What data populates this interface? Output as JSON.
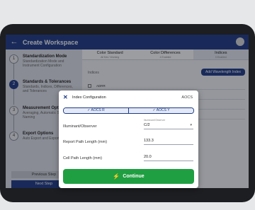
{
  "header": {
    "title": "Create Workspace",
    "back_icon": "arrow-left-icon"
  },
  "steps": [
    {
      "num": "1",
      "title": "Standardization Mode",
      "sub": "Standardization Mode and Instrument Configuration"
    },
    {
      "num": "2",
      "title": "Standards & Tolerances",
      "sub": "Standards, Indices, Differences, and Tolerances"
    },
    {
      "num": "3",
      "title": "Measurement Options",
      "sub": "Averaging, Automatic Sample Naming"
    },
    {
      "num": "4",
      "title": "Export Options",
      "sub": "Auto Export and Export Settings"
    }
  ],
  "sidebar": {
    "prev_label": "Previous Step",
    "next_label": "Next Step"
  },
  "tabs": [
    {
      "label": "Color Standard",
      "sub": "All Mst / Working"
    },
    {
      "label": "Color Differences",
      "sub": "4 Enabled"
    },
    {
      "label": "Indices",
      "sub": "0 Enabled"
    }
  ],
  "content": {
    "section_label": "Indices",
    "add_button": "Add Wavelength Index",
    "rows": [
      "ADRR",
      "",
      "",
      ""
    ]
  },
  "modal": {
    "title": "Index Configuration",
    "right_label": "AOCS",
    "options": [
      {
        "label": "✓ AOCS R"
      },
      {
        "label": "✓ AOCS Y"
      }
    ],
    "fields": [
      {
        "label": "Illuminant/Observer",
        "caption": "Illuminant/Observer",
        "value": "C/2"
      },
      {
        "label": "Report Path Length (mm)",
        "caption": "",
        "value": "133.3"
      },
      {
        "label": "Cell Path Length (mm)",
        "caption": "",
        "value": "20.0"
      }
    ],
    "continue_label": "Continue"
  },
  "colors": {
    "primary": "#1e3a86",
    "continue": "#1f9f41"
  }
}
